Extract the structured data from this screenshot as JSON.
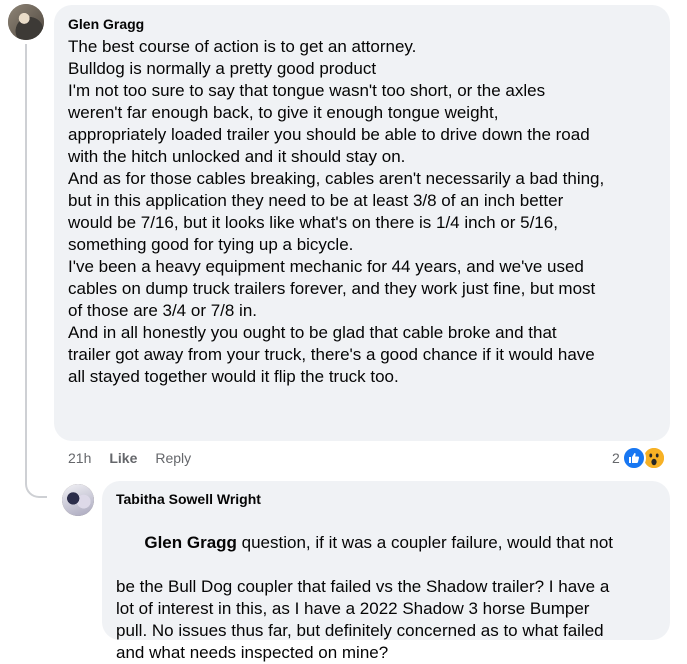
{
  "comments": [
    {
      "author": "Glen Gragg",
      "lines": [
        "The best course of action is to get an attorney.",
        "Bulldog is normally a pretty good product",
        "I'm not too sure to say that tongue wasn't too short, or the axles",
        "weren't far enough back, to give it enough tongue weight,",
        "appropriately loaded trailer you should be able to drive down the road",
        "with the hitch unlocked and it should stay on.",
        "And as for those cables breaking, cables aren't necessarily a bad thing,",
        "but in this application they need to be at least 3/8 of an inch better",
        "would be 7/16, but it looks like what's on there is 1/4 inch or 5/16,",
        "something good for tying up a bicycle.",
        "I've been a heavy equipment mechanic for 44 years, and we've used",
        "cables on dump truck trailers forever, and they work just fine, but most",
        "of those are 3/4 or 7/8 in.",
        "And in all honestly you ought to be glad that cable broke and that",
        "trailer got away from your truck, there's a good chance if it would have",
        "all stayed together would it flip the truck too."
      ],
      "time": "21h",
      "like_label": "Like",
      "reply_label": "Reply",
      "reaction_count": "2",
      "reactions": [
        "like-icon",
        "wow-icon"
      ]
    }
  ],
  "reply": {
    "author": "Tabitha Sowell Wright",
    "mention": "Glen Gragg",
    "first_line_rest": " question, if it was a coupler failure, would that not",
    "lines": [
      "be the Bull Dog coupler that failed vs the Shadow trailer? I have a",
      "lot of interest in this, as I have a 2022 Shadow 3 horse Bumper",
      "pull. No issues thus far, but definitely concerned as to what failed",
      "and what needs inspected on mine?"
    ]
  },
  "colors": {
    "bubble": "#f0f2f5",
    "meta": "#65676b",
    "like_blue": "#1877f2",
    "wow_yellow": "#f7b125"
  }
}
